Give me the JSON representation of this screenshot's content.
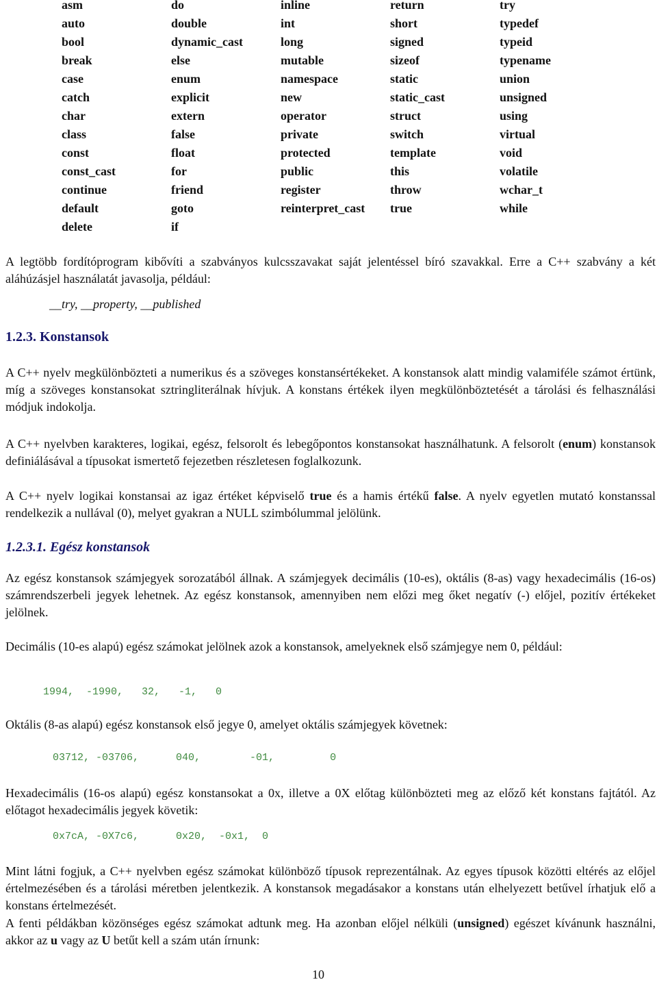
{
  "keywords": {
    "columns": [
      [
        "asm",
        "auto",
        "bool",
        "break",
        "case",
        "catch",
        "char",
        "class",
        "const",
        "const_cast",
        "continue",
        "default",
        "delete"
      ],
      [
        "do",
        "double",
        "dynamic_cast",
        "else",
        "enum",
        "explicit",
        "extern",
        "false",
        "float",
        "for",
        "friend",
        "goto",
        "if"
      ],
      [
        "inline",
        "int",
        "long",
        "mutable",
        "namespace",
        "new",
        "operator",
        "private",
        "protected",
        "public",
        "register",
        "reinterpret_cast",
        ""
      ],
      [
        "return",
        "short",
        "signed",
        "sizeof",
        "static",
        "static_cast",
        "struct",
        "switch",
        "template",
        "this",
        "throw",
        "true",
        ""
      ],
      [
        "try",
        "typedef",
        "typeid",
        "typename",
        "union",
        "unsigned",
        "using",
        "virtual",
        "void",
        "volatile",
        "wchar_t",
        "while",
        ""
      ]
    ]
  },
  "intro": {
    "paragraph": "A legtöbb fordítóprogram kibővíti a szabványos kulcsszavakat saját jelentéssel bíró szavakkal. Erre a C++ szabvány a két aláhúzásjel használatát javasolja, például:",
    "examples": "__try, __property, __published"
  },
  "section": {
    "heading": "1.2.3. Konstansok",
    "paragraphs": [
      "A C++ nyelv megkülönbözteti a numerikus és a szöveges konstansértékeket. A konstansok alatt mindig valamiféle számot értünk, míg a szöveges konstansokat sztringliterálnak hívjuk. A konstans értékek ilyen megkülönböztetését a tárolási és felhasználási módjuk indokolja."
    ],
    "p2_before": "A C++ nyelvben karakteres, logikai, egész, felsorolt és lebegőpontos konstansokat használhatunk. A felsorolt (",
    "p2_bold": "enum",
    "p2_after": ") konstansok definiálásával a típusokat ismertető fejezetben részletesen foglalkozunk.",
    "p3_before": "A C++ nyelv logikai konstansai az igaz értéket képviselő ",
    "p3_bold1": "true",
    "p3_mid": " és a hamis értékű ",
    "p3_bold2": "false",
    "p3_after": ". A nyelv egyetlen mutató konstanssal rendelkezik a nullával (0), melyet gyakran a NULL szimbólummal jelölünk."
  },
  "subsection": {
    "heading": "1.2.3.1. Egész konstansok",
    "p1": "Az egész konstansok számjegyek sorozatából állnak. A számjegyek decimális (10-es), oktális (8-as) vagy hexadecimális (16-os) számrendszerbeli jegyek lehetnek. Az egész konstansok, amennyiben nem előzi meg őket negatív (-) előjel, pozitív értékeket jelölnek.",
    "p_decimal": "Decimális (10-es alapú) egész számokat jelölnek azok a konstansok, amelyeknek első számjegye nem 0, például:",
    "code_decimal": "1994,  -1990,   32,   -1,   0",
    "p_octal": "Oktális (8-as alapú) egész konstansok első jegye 0, amelyet oktális számjegyek követnek:",
    "code_octal": "03712, -03706,      040,        -01,         0",
    "p_hex": "Hexadecimális (16-os alapú) egész konstansokat a 0x, illetve a 0X előtag különbözteti meg az előző két konstans fajtától. Az előtagot hexadecimális jegyek követik:",
    "code_hex": "0x7cA, -0X7c6,      0x20,  -0x1,  0",
    "p_types": "Mint látni fogjuk, a C++ nyelvben egész számokat különböző típusok reprezentálnak. Az egyes típusok közötti eltérés az előjel értelmezésében és a tárolási méretben jelentkezik. A konstansok megadásakor a konstans után elhelyezett betűvel írhatjuk elő a konstans értelmezését.",
    "p_unsigned_before": "A fenti példákban közönséges egész számokat adtunk meg. Ha azonban előjel nélküli (",
    "p_unsigned_bold": "unsigned",
    "p_unsigned_mid": ") egészet kívánunk használni, akkor az ",
    "p_unsigned_u": "u",
    "p_unsigned_mid2": " vagy az ",
    "p_unsigned_U": "U",
    "p_unsigned_after": " betűt kell a szám után írnunk:"
  },
  "page_number": "10"
}
